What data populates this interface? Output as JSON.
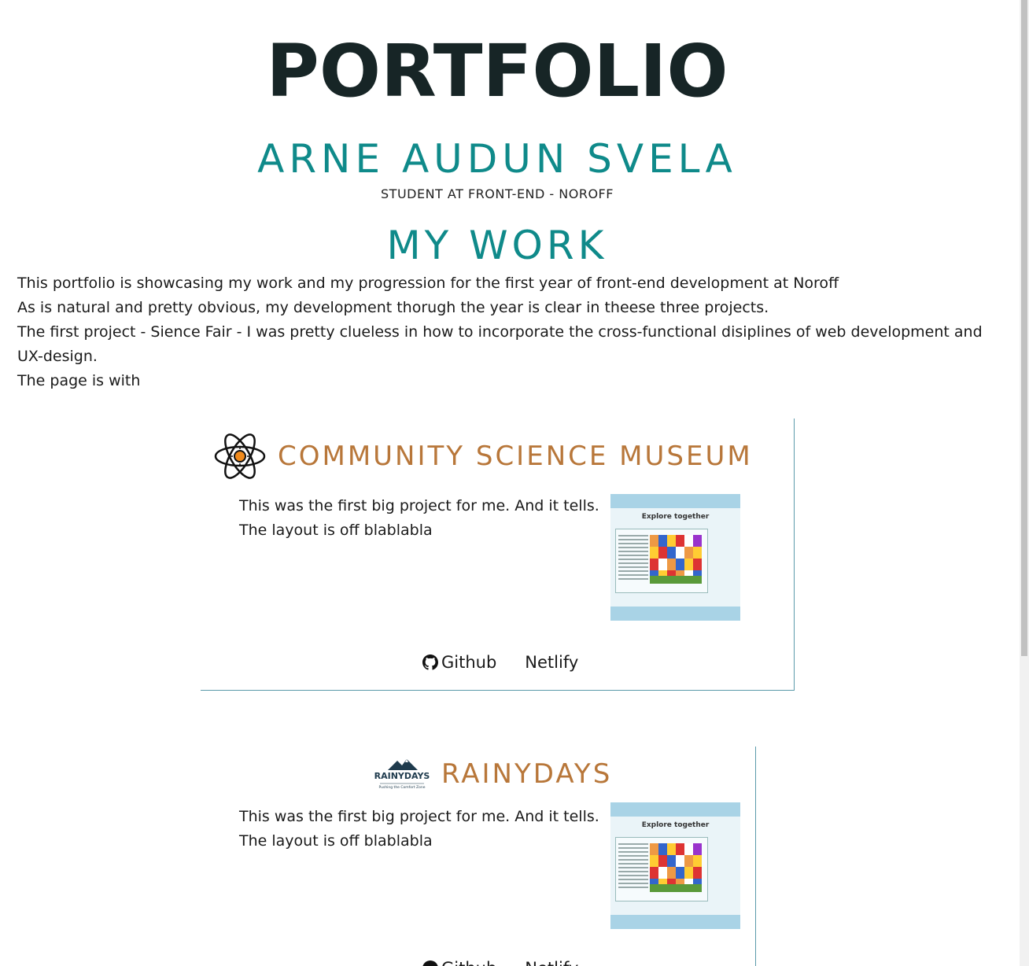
{
  "header": {
    "title": "PORTFOLIO",
    "name": "ARNE AUDUN SVELA",
    "subtitle": "STUDENT AT FRONT-END - NOROFF"
  },
  "section": {
    "title": "MY WORK",
    "intro": [
      "This portfolio is showcasing my work and my progression for the first year of front-end development at Noroff",
      "As is natural and pretty obvious, my development thorugh the year is clear in theese three projects.",
      "The first project - Sience Fair - I was pretty clueless in how to incorporate the cross-functional disiplines of web development and UX-design.",
      "The page is with"
    ]
  },
  "projects": [
    {
      "title": "COMMUNITY SCIENCE MUSEUM",
      "icon": "atom-icon",
      "text": [
        "This was the first big project for me. And it tells.",
        "The layout is off blablabla"
      ],
      "thumbnail_heading": "Explore together",
      "links": {
        "github": "Github",
        "netlify": "Netlify"
      }
    },
    {
      "title": "RAINYDAYS",
      "icon": "rainydays-logo",
      "logo_text": "RAINYDAYS",
      "logo_tagline": "Pushing the Comfort Zone",
      "text": [
        "This was the first big project for me. And it tells.",
        "The layout is off blablabla"
      ],
      "thumbnail_heading": "Explore together",
      "links": {
        "github": "Github",
        "netlify": "Netlify"
      }
    }
  ],
  "colors": {
    "accent_teal": "#0f8a8a",
    "title_dark": "#172526",
    "card_title": "#b8773a",
    "card_border": "#5a9aaa"
  }
}
